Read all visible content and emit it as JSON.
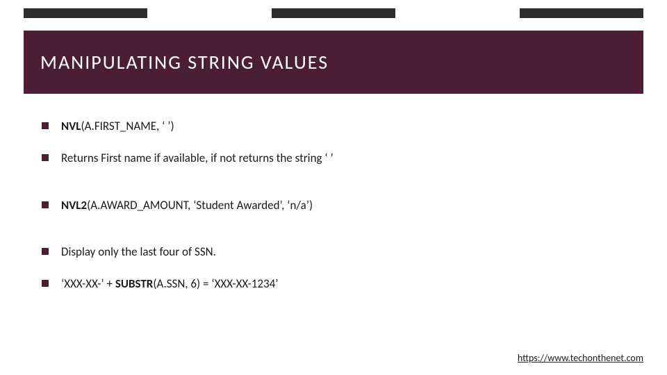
{
  "title": "MANIPULATING STRING VALUES",
  "bullets": [
    {
      "bold": "NVL",
      "rest": "(A.FIRST_NAME, ‘ ’)",
      "gap": false
    },
    {
      "bold": "",
      "rest": "Returns First name if available, if not returns the string ‘ ’",
      "gap": true
    },
    {
      "bold": "NVL2",
      "rest": "(A.AWARD_AMOUNT, ‘Student Awarded’, ‘n/a’)",
      "gap": true
    },
    {
      "bold": "",
      "rest": "Display only the last four of SSN.",
      "gap": false
    },
    {
      "bold": "",
      "pre": "‘XXX-XX-’ + ",
      "bold2": "SUBSTR",
      "rest": "(A.SSN, 6) = ‘XXX-XX-1234’",
      "gap": false
    }
  ],
  "footer": "https://www.techonthenet.com"
}
